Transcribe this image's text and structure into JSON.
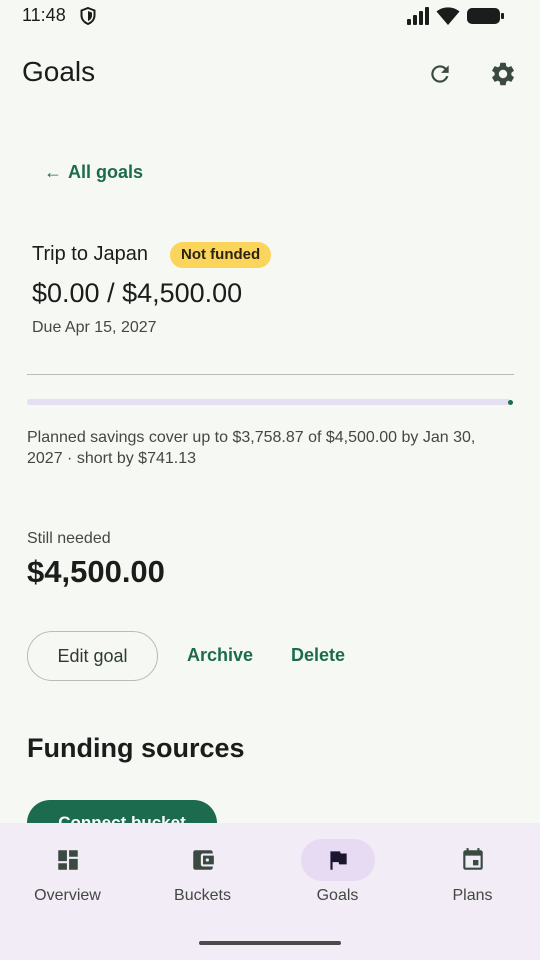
{
  "status_bar": {
    "time": "11:48",
    "icons": [
      "shield-icon",
      "signal-icon",
      "wifi-icon",
      "battery-icon"
    ]
  },
  "app_bar": {
    "title": "Goals",
    "actions": [
      "refresh-icon",
      "settings-icon"
    ]
  },
  "back_link": {
    "arrow": "←",
    "label": "All goals"
  },
  "goal": {
    "name": "Trip to Japan",
    "status": "Not funded",
    "amount": "$0.00 / $4,500.00",
    "due": "Due Apr 15, 2027",
    "progress_fraction": 0,
    "plan_note": "Planned savings cover up to $3,758.87 of $4,500.00 by Jan 30, 2027 · short by $741.13",
    "still_needed_label": "Still needed",
    "still_needed_amount": "$4,500.00"
  },
  "actions": {
    "edit": "Edit goal",
    "archive": "Archive",
    "delete": "Delete"
  },
  "funding": {
    "heading": "Funding sources",
    "connect_button": "Connect bucket"
  },
  "bottom_nav": {
    "items": [
      {
        "label": "Overview",
        "icon": "dashboard-icon"
      },
      {
        "label": "Buckets",
        "icon": "wallet-icon"
      },
      {
        "label": "Goals",
        "icon": "flag-icon",
        "active": true
      },
      {
        "label": "Plans",
        "icon": "calendar-icon"
      }
    ]
  },
  "colors": {
    "accent": "#1d6b4f",
    "badge": "#fbd55b",
    "background": "#f6f8f3",
    "nav_background": "#f1ecf6",
    "progress_track": "#e5dff4"
  }
}
